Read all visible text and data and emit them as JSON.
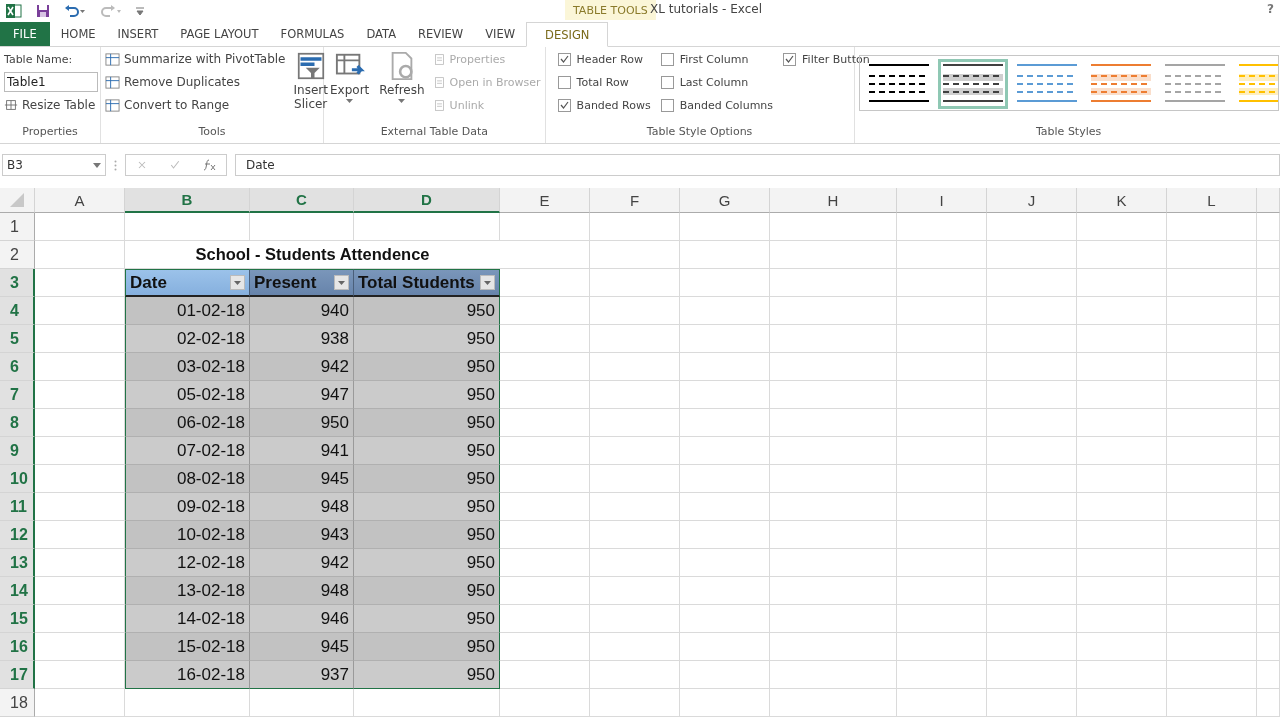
{
  "title_bar": {
    "context": "TABLE TOOLS",
    "title": "XL tutorials - Excel",
    "help": "?"
  },
  "ribbon_tabs": [
    {
      "label": "FILE",
      "kind": "file",
      "selected": false
    },
    {
      "label": "HOME",
      "kind": "normal",
      "selected": false
    },
    {
      "label": "INSERT",
      "kind": "normal",
      "selected": false
    },
    {
      "label": "PAGE LAYOUT",
      "kind": "normal",
      "selected": false
    },
    {
      "label": "FORMULAS",
      "kind": "normal",
      "selected": false
    },
    {
      "label": "DATA",
      "kind": "normal",
      "selected": false
    },
    {
      "label": "REVIEW",
      "kind": "normal",
      "selected": false
    },
    {
      "label": "VIEW",
      "kind": "normal",
      "selected": false
    },
    {
      "label": "DESIGN",
      "kind": "context",
      "selected": true
    }
  ],
  "properties": {
    "name_label": "Table Name:",
    "name_value": "Table1",
    "resize": "Resize Table",
    "group": "Properties"
  },
  "tools": {
    "items": [
      "Summarize with PivotTable",
      "Remove Duplicates",
      "Convert to Range"
    ],
    "slicer": "Insert Slicer",
    "group": "Tools"
  },
  "external_data": {
    "export": "Export",
    "refresh": "Refresh",
    "items": [
      {
        "label": "Properties",
        "disabled": true
      },
      {
        "label": "Open in Browser",
        "disabled": true
      },
      {
        "label": "Unlink",
        "disabled": true
      }
    ],
    "group": "External Table Data"
  },
  "style_options": {
    "options": [
      {
        "label": "Header Row",
        "checked": true
      },
      {
        "label": "Total Row",
        "checked": false
      },
      {
        "label": "Banded Rows",
        "checked": true
      },
      {
        "label": "First Column",
        "checked": false
      },
      {
        "label": "Last Column",
        "checked": false
      },
      {
        "label": "Banded Columns",
        "checked": false
      },
      {
        "label": "Filter Button",
        "checked": true
      }
    ],
    "group": "Table Style Options"
  },
  "table_styles": {
    "styles": [
      {
        "color": "#000000",
        "selected": false
      },
      {
        "color": "#404040",
        "selected": true
      },
      {
        "color": "#5b9bd5",
        "selected": false
      },
      {
        "color": "#ed7d31",
        "selected": false
      },
      {
        "color": "#a5a5a5",
        "selected": false
      },
      {
        "color": "#ffc000",
        "selected": false
      }
    ],
    "group": "Table Styles"
  },
  "formula_bar": {
    "name_box": "B3",
    "formula": "Date"
  },
  "sheet": {
    "columns": [
      {
        "label": "A",
        "selected": false
      },
      {
        "label": "B",
        "selected": true
      },
      {
        "label": "C",
        "selected": true
      },
      {
        "label": "D",
        "selected": true
      },
      {
        "label": "E",
        "selected": false
      },
      {
        "label": "F",
        "selected": false
      },
      {
        "label": "G",
        "selected": false
      },
      {
        "label": "H",
        "selected": false
      },
      {
        "label": "I",
        "selected": false
      },
      {
        "label": "J",
        "selected": false
      },
      {
        "label": "K",
        "selected": false
      },
      {
        "label": "L",
        "selected": false
      }
    ],
    "rows": [
      {
        "number": "1",
        "selected": false
      },
      {
        "number": "2",
        "selected": false
      },
      {
        "number": "3",
        "selected": true
      },
      {
        "number": "4",
        "selected": true
      },
      {
        "number": "5",
        "selected": true
      },
      {
        "number": "6",
        "selected": true
      },
      {
        "number": "7",
        "selected": true
      },
      {
        "number": "8",
        "selected": true
      },
      {
        "number": "9",
        "selected": true
      },
      {
        "number": "10",
        "selected": true
      },
      {
        "number": "11",
        "selected": true
      },
      {
        "number": "12",
        "selected": true
      },
      {
        "number": "13",
        "selected": true
      },
      {
        "number": "14",
        "selected": true
      },
      {
        "number": "15",
        "selected": true
      },
      {
        "number": "16",
        "selected": true
      },
      {
        "number": "17",
        "selected": true
      },
      {
        "number": "18",
        "selected": false
      }
    ],
    "title": "School - Students Attendence",
    "table": {
      "headers": [
        "Date",
        "Present",
        "Total Students"
      ],
      "rows": [
        [
          "01-02-18",
          "940",
          "950"
        ],
        [
          "02-02-18",
          "938",
          "950"
        ],
        [
          "03-02-18",
          "942",
          "950"
        ],
        [
          "05-02-18",
          "947",
          "950"
        ],
        [
          "06-02-18",
          "950",
          "950"
        ],
        [
          "07-02-18",
          "941",
          "950"
        ],
        [
          "08-02-18",
          "945",
          "950"
        ],
        [
          "09-02-18",
          "948",
          "950"
        ],
        [
          "10-02-18",
          "943",
          "950"
        ],
        [
          "12-02-18",
          "942",
          "950"
        ],
        [
          "13-02-18",
          "948",
          "950"
        ],
        [
          "14-02-18",
          "946",
          "950"
        ],
        [
          "15-02-18",
          "945",
          "950"
        ],
        [
          "16-02-18",
          "937",
          "950"
        ]
      ]
    }
  }
}
